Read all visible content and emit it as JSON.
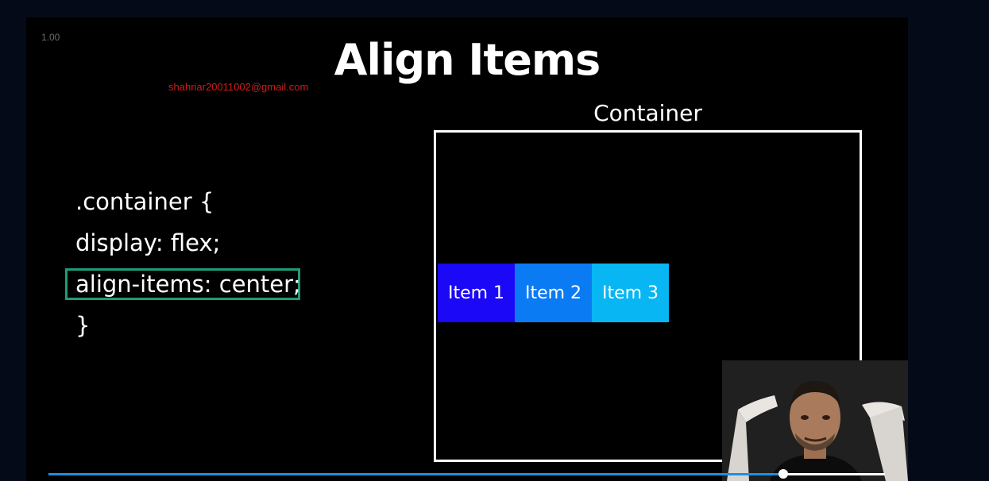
{
  "player": {
    "speed": "1.00",
    "progress_fraction": 0.878,
    "accent": "#1d8fe3"
  },
  "slide": {
    "title": "Align Items",
    "watermark": "shahriar20011002@gmail.com",
    "code_lines": [
      ".container {",
      "display: flex;",
      "align-items: center;",
      "}"
    ],
    "highlighted_line": 2,
    "highlight_color": "#1f9b77",
    "container_label": "Container",
    "items": [
      {
        "label": "Item 1",
        "color": "#1b08f6"
      },
      {
        "label": "Item 2",
        "color": "#0b7bf4"
      },
      {
        "label": "Item 3",
        "color": "#07b6f2"
      }
    ]
  },
  "webcam": {
    "icon": "presenter-webcam-icon"
  }
}
